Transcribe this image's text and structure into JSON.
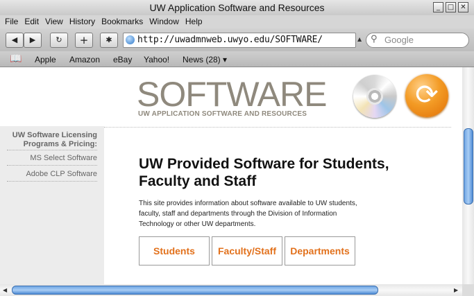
{
  "window": {
    "title": "UW Application Software and Resources",
    "controls": [
      "_",
      "□",
      "✕"
    ]
  },
  "menubar": [
    "File",
    "Edit",
    "View",
    "History",
    "Bookmarks",
    "Window",
    "Help"
  ],
  "toolbar": {
    "back_glyph": "◀",
    "forward_glyph": "▶",
    "reload_glyph": "↻",
    "add_glyph": "+",
    "bug_glyph": "✱",
    "url": "http://uwadmnweb.uwyo.edu/SOFTWARE/",
    "search_placeholder": "Google",
    "search_glyph": "⚲"
  },
  "bookmarks": {
    "icon": "📖",
    "items": [
      "Apple",
      "Amazon",
      "eBay",
      "Yahoo!",
      "News (28) ▾"
    ]
  },
  "page": {
    "logo_title": "SOFTWARE",
    "logo_subtitle": "UW APPLICATION SOFTWARE AND RESOURCES",
    "sync_glyph": "⟳",
    "sidebar": {
      "heading": "UW Software Licensing Programs & Pricing:",
      "links": [
        "MS Select Software",
        "Adobe CLP Software"
      ]
    },
    "headline": "UW Provided Software for Students, Faculty and Staff",
    "intro": "This site provides information about software available to UW students, faculty, staff and departments through the Division of Information Technology or other UW departments.",
    "buttons": [
      "Students",
      "Faculty/Staff",
      "Departments"
    ]
  },
  "colors": {
    "accent": "#e2711c",
    "logo": "#8f897d",
    "scroll_thumb": "#6fa5e3"
  }
}
